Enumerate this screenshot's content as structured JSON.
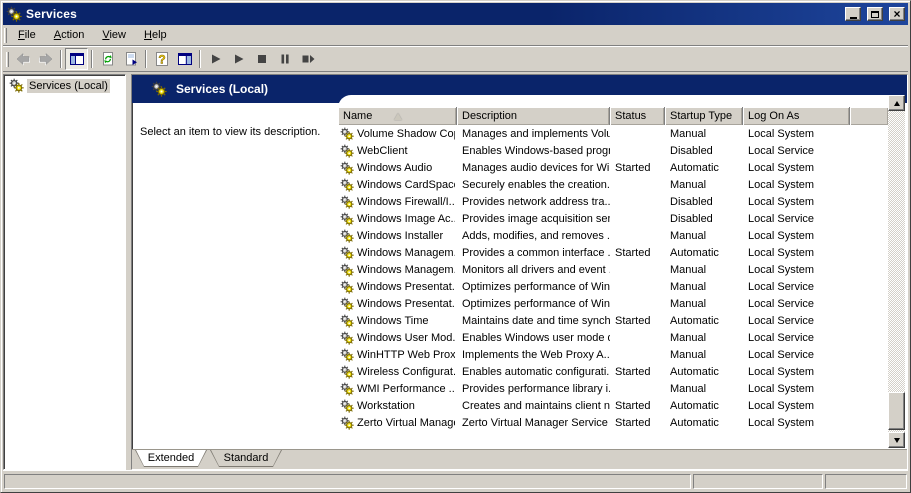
{
  "window": {
    "title": "Services"
  },
  "window_controls": [
    "minimize",
    "maximize",
    "close"
  ],
  "menu": {
    "items": [
      {
        "label": "File",
        "underline": 0
      },
      {
        "label": "Action",
        "underline": 0
      },
      {
        "label": "View",
        "underline": 0
      },
      {
        "label": "Help",
        "underline": 0
      }
    ]
  },
  "toolbar": {
    "buttons": [
      {
        "icon": "back-arrow",
        "disabled": true
      },
      {
        "icon": "forward-arrow",
        "disabled": true
      },
      {
        "icon": "separator"
      },
      {
        "icon": "show-hide-console-tree",
        "pressed": true
      },
      {
        "icon": "separator"
      },
      {
        "icon": "refresh"
      },
      {
        "icon": "export-list"
      },
      {
        "icon": "separator"
      },
      {
        "icon": "help"
      },
      {
        "icon": "show-hide-action-pane"
      },
      {
        "icon": "separator"
      },
      {
        "icon": "start-service"
      },
      {
        "icon": "resume-service"
      },
      {
        "icon": "stop-service"
      },
      {
        "icon": "pause-service"
      },
      {
        "icon": "restart-service"
      }
    ]
  },
  "sidebar": {
    "items": [
      {
        "label": "Services (Local)",
        "icon": "services-gears",
        "selected": true
      }
    ]
  },
  "main": {
    "band_title": "Services (Local)",
    "band_icon": "services-gears",
    "hint": "Select an item to view its description."
  },
  "table": {
    "columns": [
      {
        "label": "Name",
        "sort": "asc"
      },
      {
        "label": "Description"
      },
      {
        "label": "Status"
      },
      {
        "label": "Startup Type"
      },
      {
        "label": "Log On As"
      }
    ],
    "rows": [
      {
        "name": "Volume Shadow Copy",
        "description": "Manages and implements Volu...",
        "status": "",
        "startup_type": "Manual",
        "log_on_as": "Local System"
      },
      {
        "name": "WebClient",
        "description": "Enables Windows-based progr...",
        "status": "",
        "startup_type": "Disabled",
        "log_on_as": "Local Service"
      },
      {
        "name": "Windows Audio",
        "description": "Manages audio devices for Wi...",
        "status": "Started",
        "startup_type": "Automatic",
        "log_on_as": "Local System"
      },
      {
        "name": "Windows CardSpace",
        "description": "Securely enables the creation...",
        "status": "",
        "startup_type": "Manual",
        "log_on_as": "Local System"
      },
      {
        "name": "Windows Firewall/I...",
        "description": "Provides network address tra...",
        "status": "",
        "startup_type": "Disabled",
        "log_on_as": "Local System"
      },
      {
        "name": "Windows Image Ac...",
        "description": "Provides image acquisition ser...",
        "status": "",
        "startup_type": "Disabled",
        "log_on_as": "Local Service"
      },
      {
        "name": "Windows Installer",
        "description": "Adds, modifies, and removes ...",
        "status": "",
        "startup_type": "Manual",
        "log_on_as": "Local System"
      },
      {
        "name": "Windows Managem...",
        "description": "Provides a common interface ...",
        "status": "Started",
        "startup_type": "Automatic",
        "log_on_as": "Local System"
      },
      {
        "name": "Windows Managem...",
        "description": "Monitors all drivers and event ...",
        "status": "",
        "startup_type": "Manual",
        "log_on_as": "Local System"
      },
      {
        "name": "Windows Presentat...",
        "description": "Optimizes performance of Win...",
        "status": "",
        "startup_type": "Manual",
        "log_on_as": "Local Service"
      },
      {
        "name": "Windows Presentat...",
        "description": "Optimizes performance of Win...",
        "status": "",
        "startup_type": "Manual",
        "log_on_as": "Local Service"
      },
      {
        "name": "Windows Time",
        "description": "Maintains date and time synch...",
        "status": "Started",
        "startup_type": "Automatic",
        "log_on_as": "Local Service"
      },
      {
        "name": "Windows User Mod...",
        "description": "Enables Windows user mode d...",
        "status": "",
        "startup_type": "Manual",
        "log_on_as": "Local Service"
      },
      {
        "name": "WinHTTP Web Prox...",
        "description": "Implements the Web Proxy A...",
        "status": "",
        "startup_type": "Manual",
        "log_on_as": "Local Service"
      },
      {
        "name": "Wireless Configurat...",
        "description": "Enables automatic configurati...",
        "status": "Started",
        "startup_type": "Automatic",
        "log_on_as": "Local System"
      },
      {
        "name": "WMI Performance ...",
        "description": "Provides performance library i...",
        "status": "",
        "startup_type": "Manual",
        "log_on_as": "Local System"
      },
      {
        "name": "Workstation",
        "description": "Creates and maintains client n...",
        "status": "Started",
        "startup_type": "Automatic",
        "log_on_as": "Local System"
      },
      {
        "name": "Zerto Virtual Manager",
        "description": "Zerto Virtual Manager Service",
        "status": "Started",
        "startup_type": "Automatic",
        "log_on_as": "Local System"
      }
    ]
  },
  "tabs": [
    {
      "label": "Extended",
      "active": true
    },
    {
      "label": "Standard",
      "active": false
    }
  ],
  "status_bar": {
    "panels": [
      "",
      "",
      ""
    ]
  },
  "colors": {
    "titlebar": "#0a246a",
    "band": "#0a246a",
    "chrome": "#d4d0c8",
    "selection_inactive": "#d4d0c8",
    "list_background": "#ffffff"
  }
}
